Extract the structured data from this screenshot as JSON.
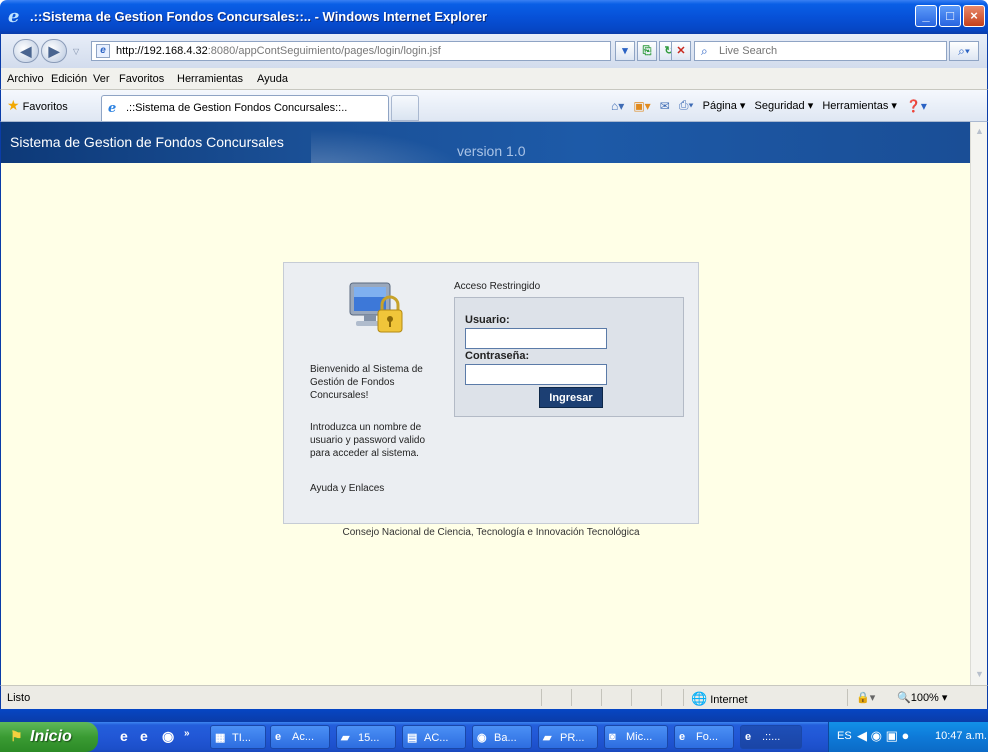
{
  "window": {
    "title": ".::Sistema de Gestion Fondos Concursales::.. - Windows Internet Explorer",
    "minimize": "_",
    "maximize": "□",
    "close": "×"
  },
  "address_bar": {
    "url_host": "http://192.168.4.32",
    "url_path": ":8080/appContSeguimiento/pages/login/login.jsf",
    "search_placeholder": "Live Search"
  },
  "menu": [
    "Archivo",
    "Edición",
    "Ver",
    "Favoritos",
    "Herramientas",
    "Ayuda"
  ],
  "favorites_bar": {
    "favorites_label": "Favoritos",
    "tab_label": ".::Sistema de Gestion Fondos Concursales::..",
    "commands": [
      "Página ▾",
      "Seguridad ▾",
      "Herramientas ▾"
    ]
  },
  "page": {
    "banner_title": "Sistema de Gestion de Fondos Concursales",
    "banner_version": "version 1.0",
    "welcome_text": "Bienvenido al Sistema de Gestión de Fondos Concursales!",
    "intro_text": "Introduzca un nombre de usuario y password valido para acceder al sistema.",
    "help_link": "Ayuda y Enlaces",
    "restricted_label": "Acceso Restringido",
    "user_label": "Usuario:",
    "user_value": "",
    "password_label": "Contraseña:",
    "password_value": "",
    "submit_label": "Ingresar",
    "footer": "Consejo Nacional de Ciencia, Tecnología e Innovación Tecnológica"
  },
  "status_bar": {
    "status": "Listo",
    "zone": "Internet",
    "zoom": "100%"
  },
  "taskbar": {
    "start_label": "Inicio",
    "tasks": [
      "TI...",
      "Ac...",
      "15...",
      "AC...",
      "Ba...",
      "PR...",
      "Mic...",
      "Fo...",
      ".::..."
    ],
    "language": "ES",
    "clock": "10:47 a.m."
  },
  "colors": {
    "title_bar": "#0751d8",
    "banner": "#1a4f95",
    "page_background": "#ffffe7",
    "submit_button": "#1c3f73"
  }
}
